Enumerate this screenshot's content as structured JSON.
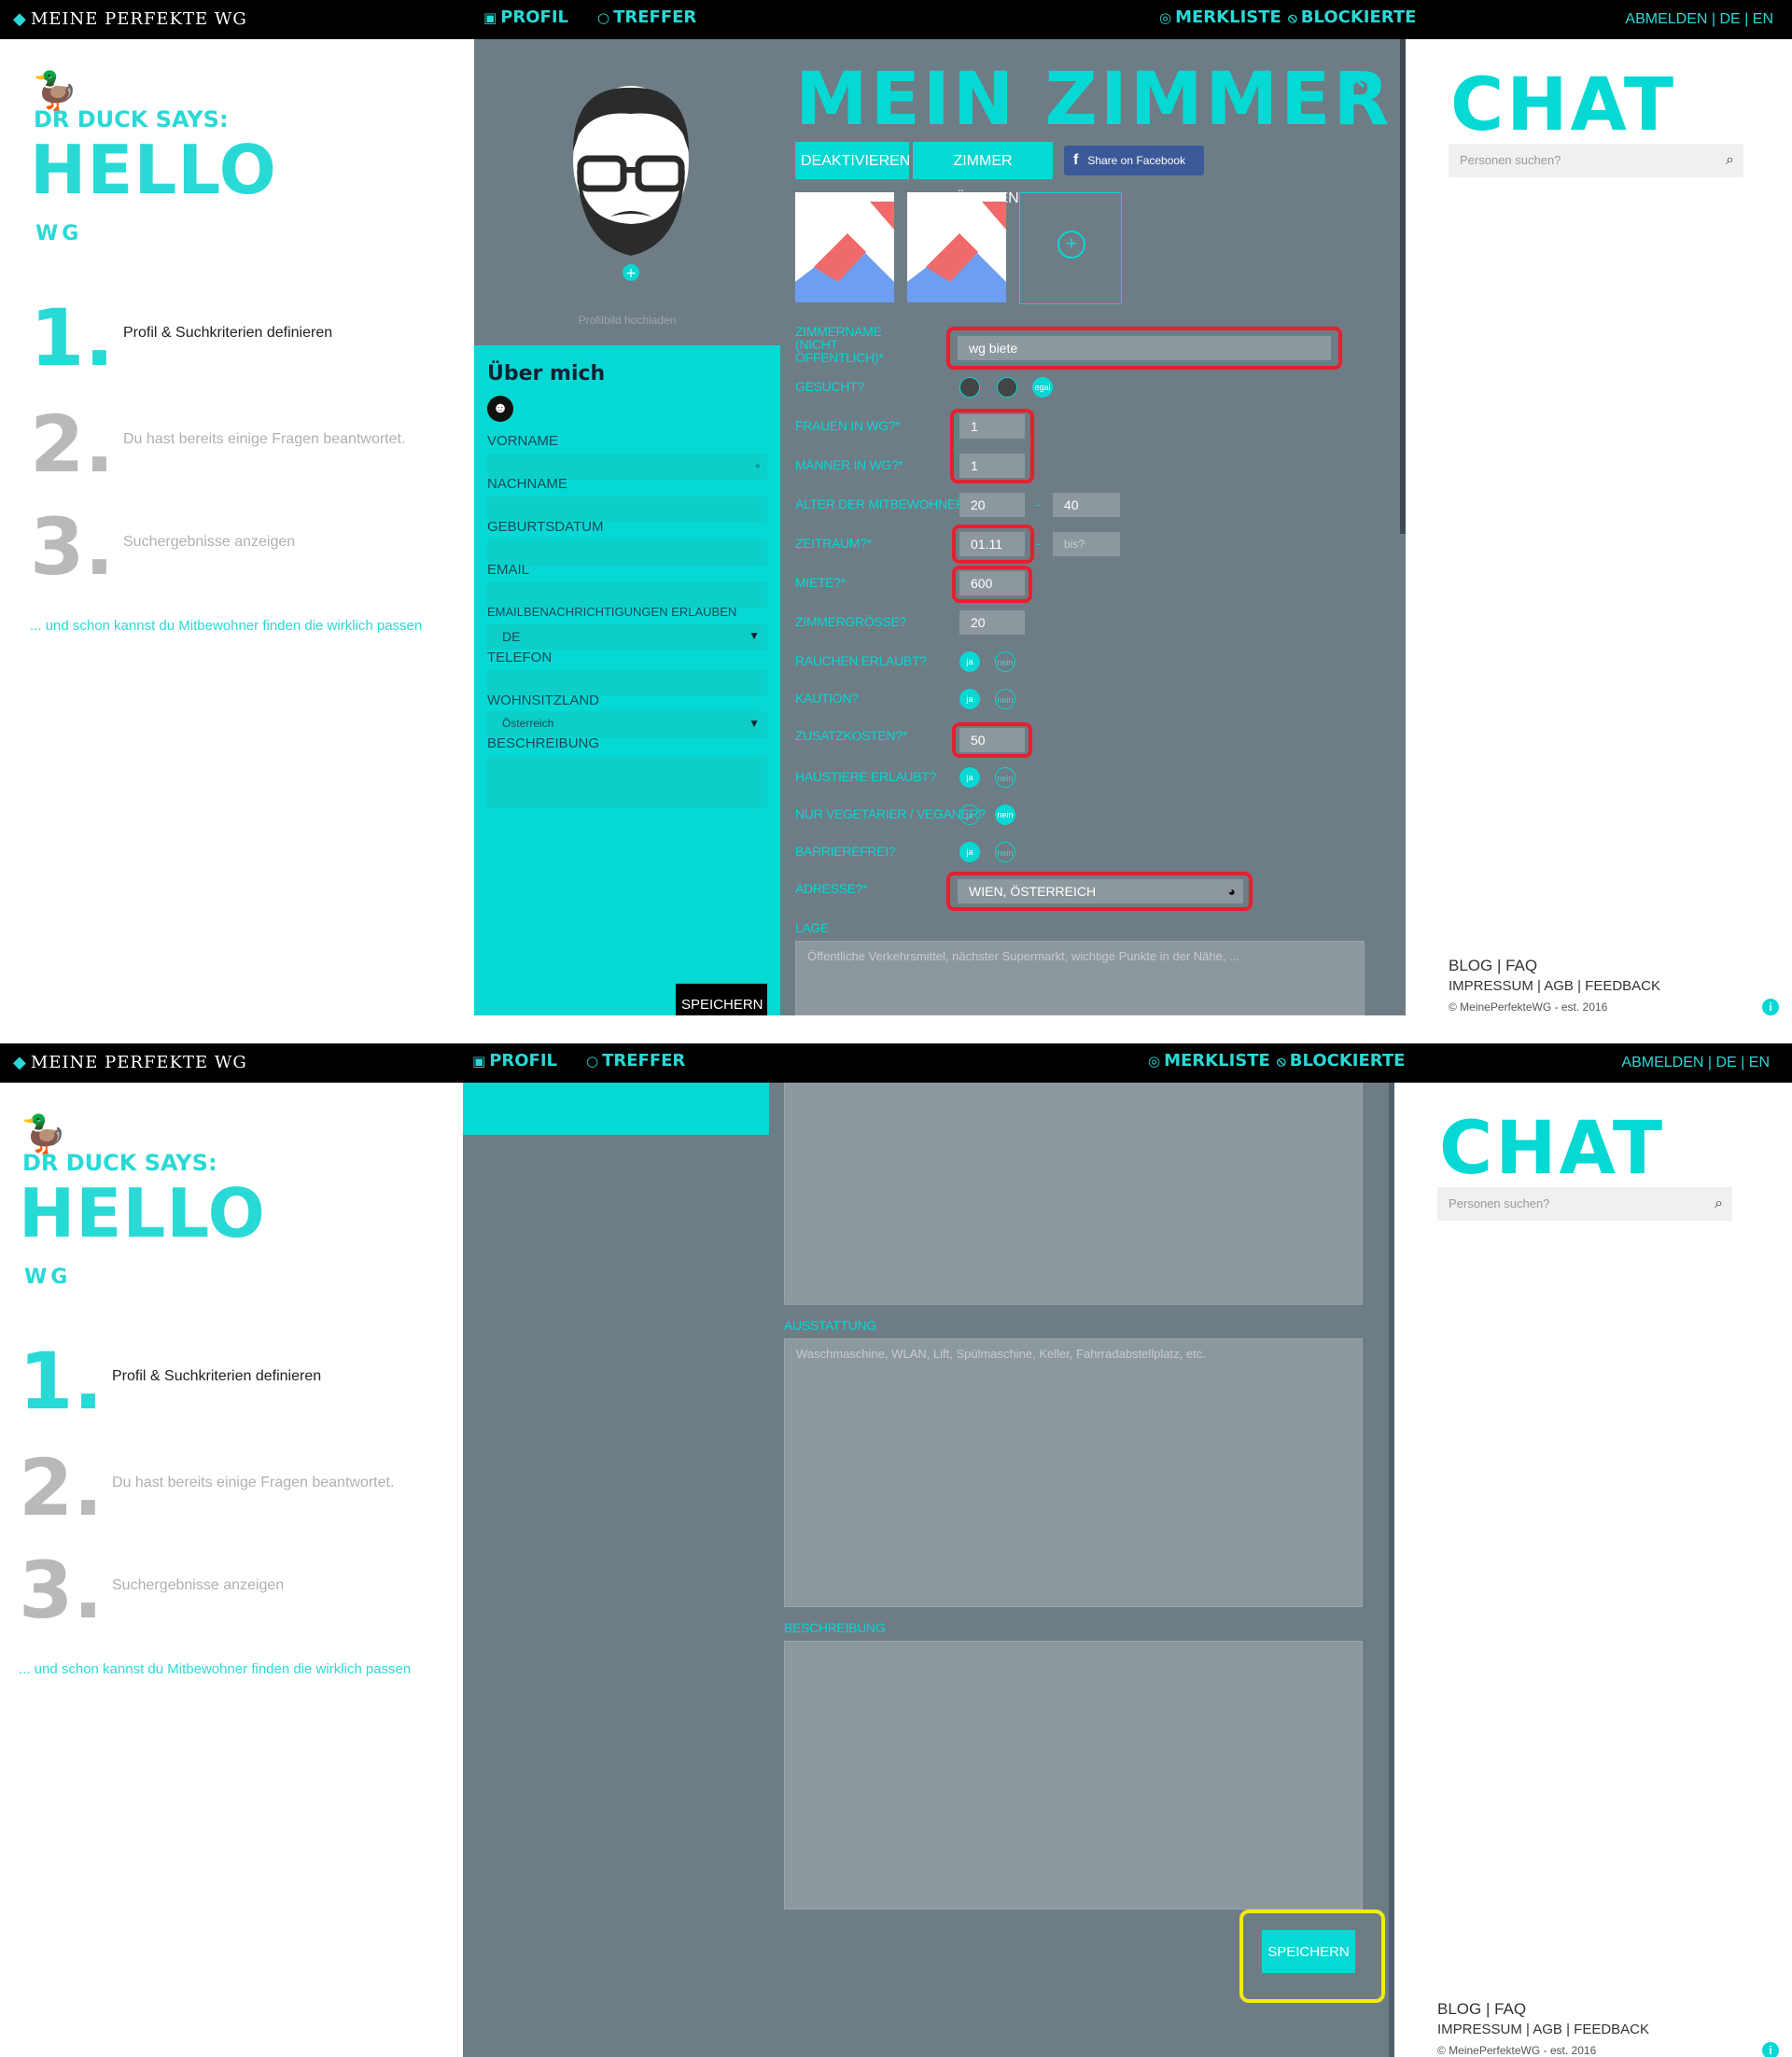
{
  "topbar": {
    "logo": "MEINE PERFEKTE WG",
    "nav_profil": "PROFIL",
    "nav_treffer": "TREFFER",
    "nav_merkliste": "MERKLISTE",
    "nav_blockierte": "BLOCKIERTE",
    "abmelden": "ABMELDEN |",
    "lang_de": "DE",
    "lang_sep": "|",
    "lang_en": "EN"
  },
  "left": {
    "dr_duck": "DR DUCK SAYS:",
    "hello": "HELLO",
    "wg": "WG",
    "steps": [
      {
        "num": "1.",
        "text": "Profil & Suchkriterien definieren"
      },
      {
        "num": "2.",
        "text": "Du hast bereits einige Fragen beantwortet."
      },
      {
        "num": "3.",
        "text": "Suchergebnisse anzeigen"
      }
    ],
    "tagline": "... und schon kannst du Mitbewohner finden die wirklich passen"
  },
  "profile": {
    "upload_label": "Profilbild hochladen",
    "title": "Über mich",
    "fields": {
      "vorname": "VORNAME",
      "nachname": "NACHNAME",
      "geburtsdatum": "GEBURTSDATUM",
      "email": "EMAIL",
      "email_notif": "EMAILBENACHRICHTIGUNGEN ERLAUBEN",
      "email_notif_value": "DE",
      "telefon": "TELEFON",
      "wohnsitzland": "WOHNSITZLAND",
      "wohnsitzland_value": "Österreich",
      "beschreibung": "BESCHREIBUNG"
    },
    "save": "SPEICHERN"
  },
  "room": {
    "title": "MEIN ZIMMER",
    "deactivate": "DEAKTIVIEREN",
    "delete": "ZIMMER LÖSCHEN",
    "facebook": "Share on Facebook",
    "labels": {
      "zimmername": "ZIMMERNAME (NICHT ÖFFENTLICH)*",
      "gesucht": "GESUCHT?",
      "frauen": "FRAUEN IN WG?*",
      "maenner": "MÄNNER IN WG?*",
      "alter": "ALTER DER MITBEWOHNER?",
      "zeitraum": "ZEITRAUM?*",
      "miete": "MIETE?*",
      "groesse": "ZIMMERGRÖSSE?",
      "rauchen": "RAUCHEN ERLAUBT?",
      "kaution": "KAUTION?",
      "zusatz": "ZUSATZKOSTEN?*",
      "haustiere": "HAUSTIERE ERLAUBT?",
      "vegetarier": "NUR VEGETARIER / VEGANER?",
      "barrierefrei": "BARRIEREFREI?",
      "adresse": "ADRESSE?*",
      "lage": "LAGE",
      "ausstattung": "AUSSTATTUNG",
      "beschreibung": "BESCHREIBUNG"
    },
    "values": {
      "zimmername": "wg biete",
      "gesucht_egal": "egal",
      "frauen": "1",
      "maenner": "1",
      "alter_von": "20",
      "alter_sep": "-",
      "alter_bis": "40",
      "zeitraum_von": "01.11",
      "zeitraum_sep": "-",
      "zeitraum_bis": "bis?",
      "miete": "600",
      "groesse": "20",
      "zusatz": "50",
      "adresse": "WIEN, ÖSTERREICH",
      "ja": "ja",
      "nein": "nein"
    },
    "placeholders": {
      "lage": "Öffentliche Verkehrsmittel, nächster Supermarkt, wichtige Punkte in der Nähe, ...",
      "ausstattung": "Waschmaschine, WLAN, Lift, Spülmaschine, Keller, Fahrradabstellplatz, etc."
    },
    "save": "SPEICHERN"
  },
  "chat": {
    "title": "CHAT",
    "search_placeholder": "Personen suchen?",
    "footer_blog": "BLOG | FAQ",
    "footer_links": "IMPRESSUM | AGB | FEEDBACK",
    "footer_copy": "© MeinePerfekteWG - est. 2016"
  },
  "colors": {
    "accent": "#06d8d4",
    "panel": "#6e7c85",
    "highlight_red": "#e5202e",
    "highlight_yellow": "#f1ea18"
  }
}
